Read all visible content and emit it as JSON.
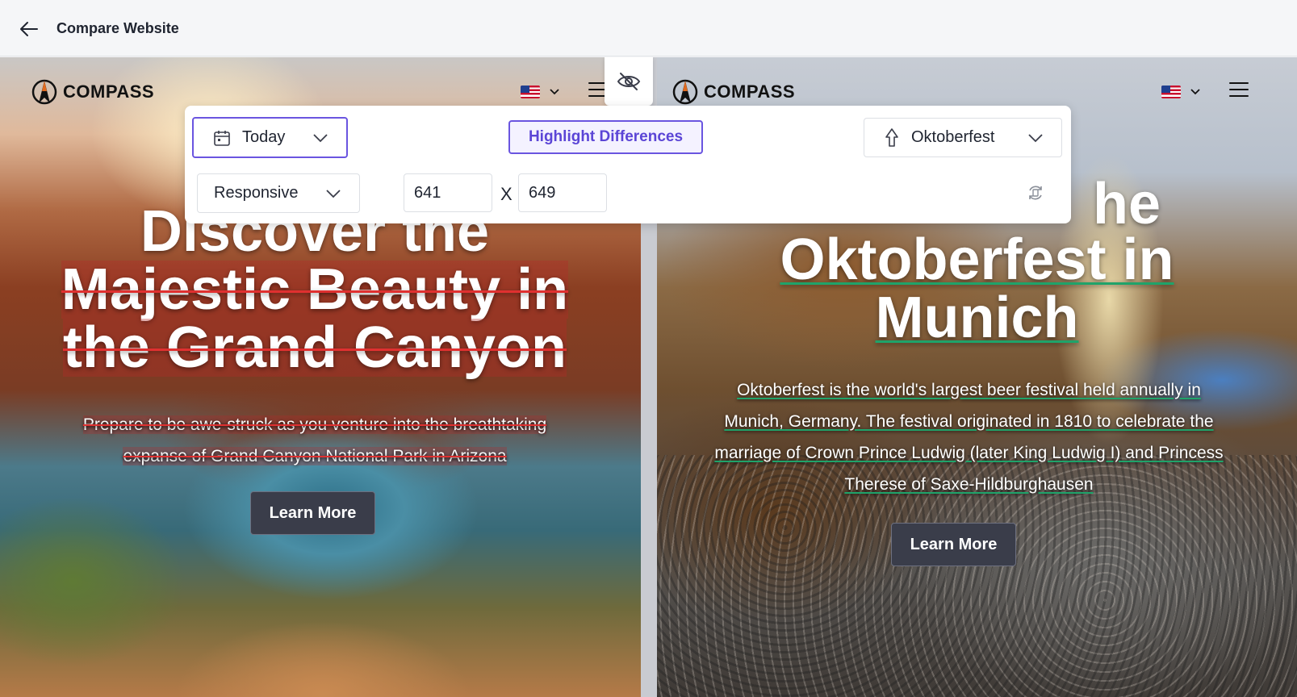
{
  "header": {
    "title": "Compare Website"
  },
  "left_site": {
    "logo_text": "COMPASS",
    "hero": {
      "title_line1": "Discover the",
      "title_line2": "Majestic Beauty in",
      "title_line3": "the Grand Canyon",
      "subtitle_line1": "Prepare to be awe-struck as you venture into the breathtaking",
      "subtitle_line2": "expanse of Grand Canyon National Park in Arizona",
      "cta": "Learn More"
    }
  },
  "right_site": {
    "logo_text": "COMPASS",
    "hero": {
      "title_line0": "he",
      "title_line1": "Oktoberfest in",
      "title_line2": "Munich",
      "subtitle_line1": "Oktoberfest is the world's largest beer festival held annually in",
      "subtitle_line2": "Munich, Germany. The festival originated in 1810 to celebrate the",
      "subtitle_line3": "marriage of Crown Prince Ludwig (later King Ludwig I) and Princess",
      "subtitle_line4": "Therese of Saxe-Hildburghausen",
      "cta": "Learn More"
    }
  },
  "toolbar": {
    "date_select": "Today",
    "highlight_button": "Highlight Differences",
    "theme_select": "Oktoberfest",
    "viewport_select": "Responsive",
    "width_value": "641",
    "height_value": "649",
    "separator": "X"
  },
  "colors": {
    "accent": "#6a55e0",
    "removed": "#e03030",
    "added": "#1fa36a",
    "button_dark": "#3a3d4a"
  },
  "icons": {
    "back": "arrow-left-icon",
    "eye": "eye-off-icon",
    "calendar": "calendar-icon",
    "pin": "location-pin-icon",
    "rotate": "rotate-device-icon",
    "chevron": "chevron-down-icon",
    "flag": "us-flag-icon",
    "menu": "hamburger-menu-icon"
  }
}
